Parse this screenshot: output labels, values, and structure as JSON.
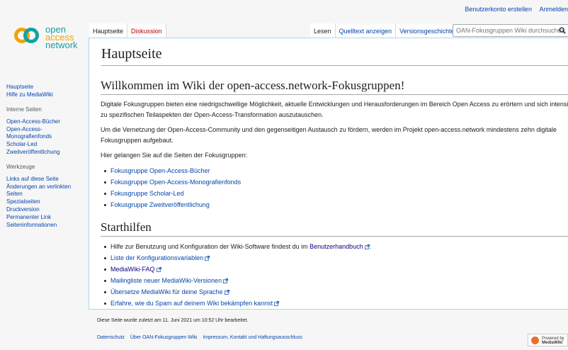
{
  "personal_tools": {
    "create_account": "Benutzerkonto erstellen",
    "login": "Anmelden"
  },
  "logo": {
    "line1": "open",
    "line2": "access",
    "line3": "network"
  },
  "sidebar": {
    "main": [
      {
        "label": "Hauptseite"
      },
      {
        "label": "Hilfe zu MediaWiki"
      }
    ],
    "internal": {
      "heading": "Interne Seiten",
      "items": [
        {
          "label": "Open-Access-Bücher"
        },
        {
          "label": "Open-Access-Monografienfonds"
        },
        {
          "label": "Scholar-Led"
        },
        {
          "label": "Zweitveröffentlichung"
        }
      ]
    },
    "tools": {
      "heading": "Werkzeuge",
      "items": [
        {
          "label": "Links auf diese Seite"
        },
        {
          "label": "Änderungen an verlinkten Seiten"
        },
        {
          "label": "Spezialseiten"
        },
        {
          "label": "Druckversion"
        },
        {
          "label": "Permanenter Link"
        },
        {
          "label": "Seiteninformationen"
        }
      ]
    }
  },
  "tabs": {
    "main_page": "Hauptseite",
    "discussion": "Diskussion",
    "read": "Lesen",
    "view_source": "Quelltext anzeigen",
    "history": "Versionsgeschichte"
  },
  "search": {
    "placeholder": "OAN-Fokusgruppen Wiki durchsuchen"
  },
  "page": {
    "title": "Hauptseite",
    "welcome_heading": "Willkommen im Wiki der open-access.network-Fokusgruppen!",
    "para1": "Digitale Fokusgruppen bieten eine niedrigschwellige Möglichkeit, aktuelle Entwicklungen und Herausforderungen im Bereich Open Access zu erörtern und sich intensiv zu spezifischen Teilaspekten der Open-Access-Transformation auszutauschen.",
    "para2": "Um die Vernetzung der Open-Access-Community und den gegenseitigen Austausch zu fördern, werden im Projekt open-access.network mindestens zehn digitale Fokusgruppen aufgebaut.",
    "para3": "Hier gelangen Sie auf die Seiten der Fokusgruppen:",
    "groups": [
      {
        "label": "Fokusgruppe Open-Access-Bücher"
      },
      {
        "label": "Fokusgruppe Open-Access-Monografienfonds"
      },
      {
        "label": "Fokusgruppe Scholar-Led"
      },
      {
        "label": "Fokusgruppe Zweitveröffentlichung"
      }
    ],
    "start_heading": "Starthilfen",
    "help_text": "Hilfe zur Benutzung und Konfiguration der Wiki-Software findest du im ",
    "help_link": "Benutzerhandbuch",
    "help_end": ".",
    "start_links": [
      {
        "label": "Liste der Konfigurationsvariablen"
      },
      {
        "label": "MediaWiki-FAQ"
      },
      {
        "label": "Mailingliste neuer MediaWiki-Versionen"
      },
      {
        "label": "Übersetze MediaWiki für deine Sprache"
      },
      {
        "label": "Erfahre, wie du Spam auf deinem Wiki bekämpfen kannst"
      }
    ]
  },
  "footer": {
    "last_mod": "Diese Seite wurde zuletzt am 11. Juni 2021 um 10:52 Uhr bearbeitet.",
    "privacy": "Datenschutz",
    "about": "Über OAN-Fokusgruppen Wiki",
    "imprint": "Impressum, Kontakt und Haftungsausschluss",
    "powered_line1": "Powered by",
    "powered_line2": "MediaWiki"
  }
}
